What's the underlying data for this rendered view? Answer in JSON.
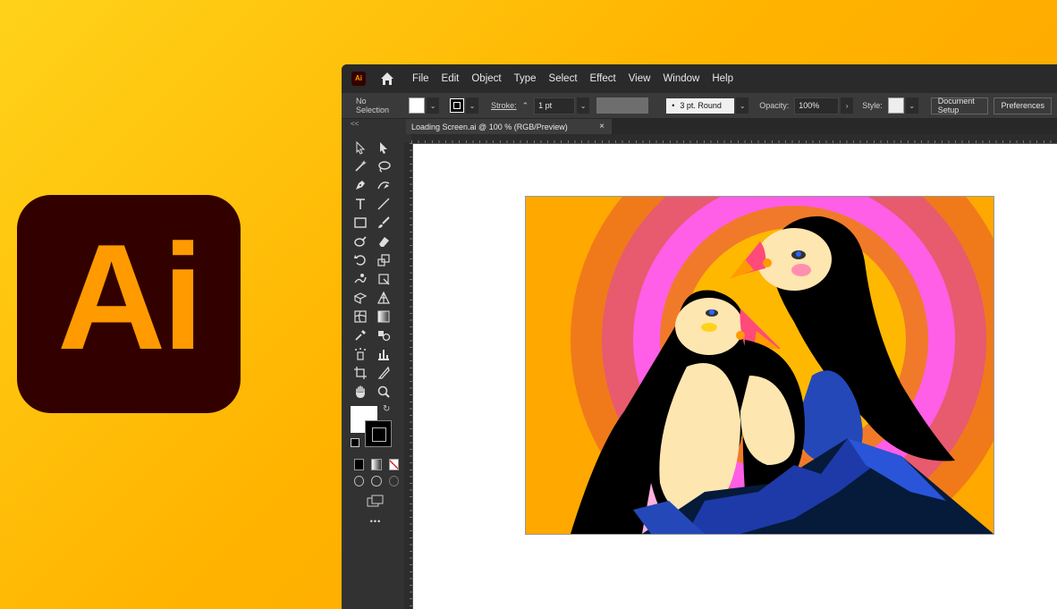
{
  "logo": {
    "text": "Ai"
  },
  "app_icon": {
    "text": "Ai"
  },
  "menu": [
    "File",
    "Edit",
    "Object",
    "Type",
    "Select",
    "Effect",
    "View",
    "Window",
    "Help"
  ],
  "control": {
    "selection": "No Selection",
    "stroke_label": "Stroke:",
    "stroke_weight": "1 pt",
    "brush": "3 pt. Round",
    "opacity_label": "Opacity:",
    "opacity_value": "100%",
    "style_label": "Style:",
    "doc_setup": "Document Setup",
    "preferences": "Preferences"
  },
  "document": {
    "tab_title": "Loading Screen.ai @ 100 % (RGB/Preview)",
    "close": "×"
  },
  "panel": {
    "collapse": "<<",
    "more": "•••"
  },
  "colors": {
    "background_start": "#ffd21a",
    "background_end": "#ff9f00",
    "logo_bg": "#330000",
    "logo_fg": "#ff9a00",
    "ui_dark": "#323232"
  },
  "icons": [
    "home-icon",
    "selection-tool-icon",
    "direct-selection-icon",
    "magic-wand-icon",
    "lasso-icon",
    "pen-icon",
    "curvature-icon",
    "type-icon",
    "line-icon",
    "rectangle-icon",
    "paintbrush-icon",
    "shaper-icon",
    "eraser-icon",
    "rotate-icon",
    "scale-icon",
    "warp-icon",
    "free-transform-icon",
    "shape-builder-icon",
    "perspective-icon",
    "mesh-icon",
    "gradient-icon",
    "eyedropper-icon",
    "blend-icon",
    "symbol-sprayer-icon",
    "graph-icon",
    "artboard-icon",
    "slice-icon",
    "hand-icon",
    "zoom-icon"
  ]
}
